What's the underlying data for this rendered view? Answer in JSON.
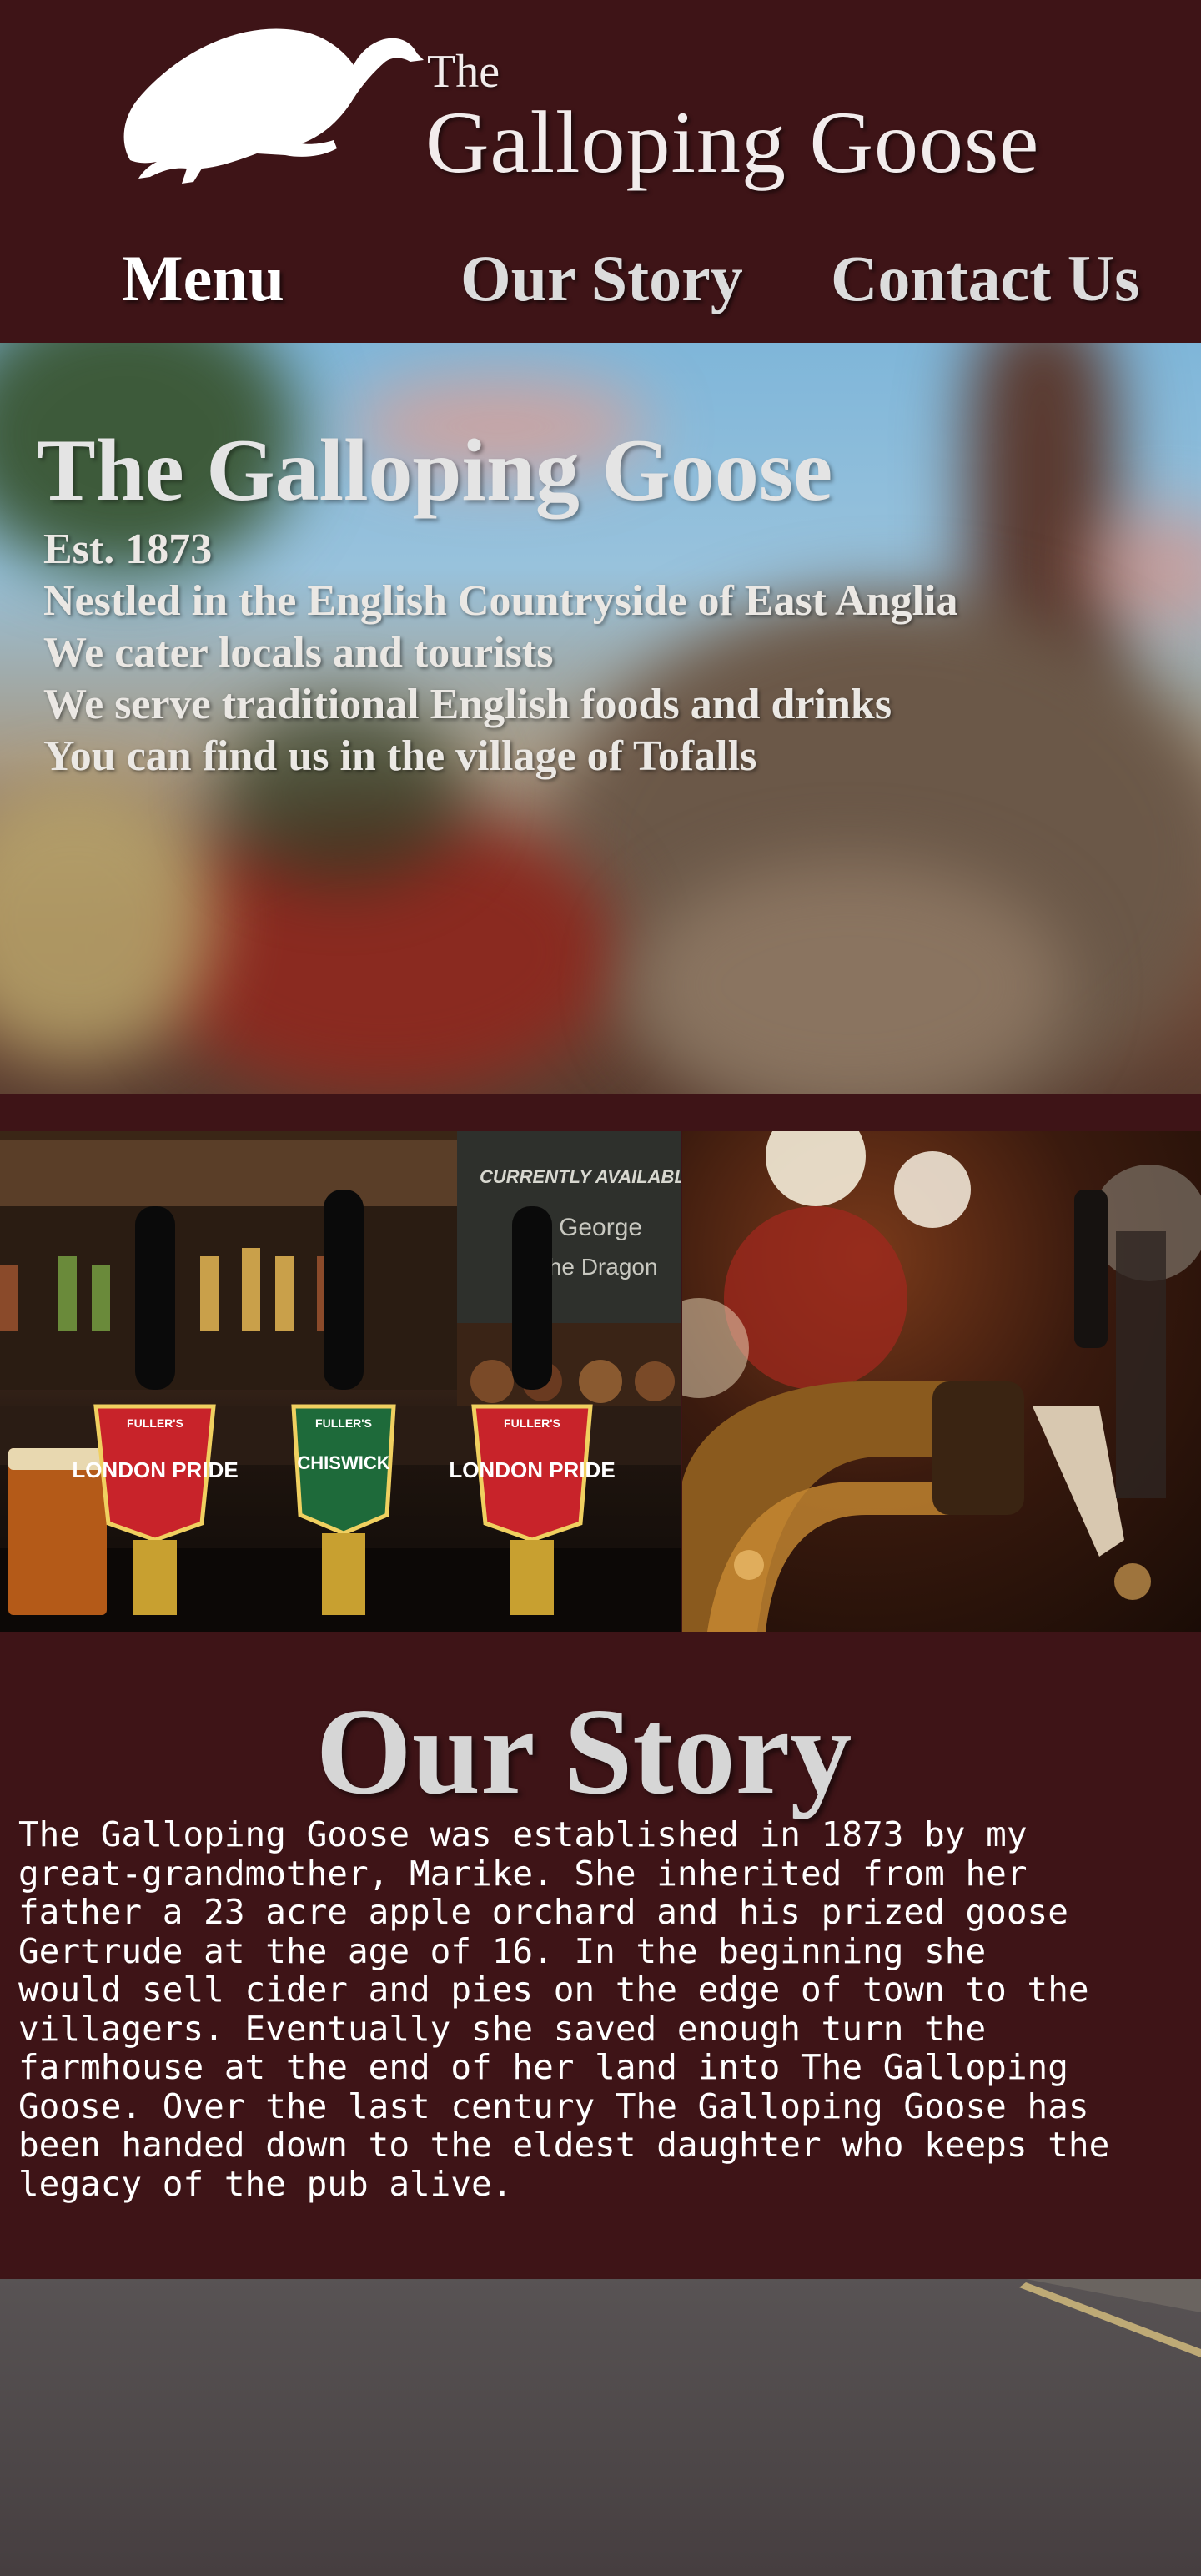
{
  "logo": {
    "the": "The",
    "name": "Galloping Goose",
    "icon": "goose-icon"
  },
  "nav": {
    "items": [
      {
        "label": "Menu"
      },
      {
        "label": "Our Story"
      },
      {
        "label": "Contact Us"
      }
    ]
  },
  "hero": {
    "title": "The Galloping Goose",
    "lines": [
      "Est. 1873",
      "Nestled in the English Countryside of East Anglia",
      "We cater locals and tourists",
      "We serve traditional English foods and drinks",
      "You can find us in the village of Tofalls"
    ],
    "image": "pub-exterior-photo"
  },
  "gallery": {
    "left": {
      "image": "beer-pumps-photo",
      "chalkboard": [
        "CURRENTLY AVAILABLE",
        "George",
        "the Dragon"
      ],
      "pumps": [
        {
          "brand": "FULLER'S",
          "name": "LONDON PRIDE"
        },
        {
          "brand": "FULLER'S",
          "name": "CHISWICK"
        },
        {
          "brand": "FULLER'S",
          "name": "LONDON PRIDE"
        }
      ]
    },
    "right": {
      "image": "beer-tap-photo"
    }
  },
  "story": {
    "title": "Our Story",
    "body": "The Galloping Goose was established in 1873 by my\ngreat-grandmother, Marike. She inherited from her\nfather a 23 acre apple orchard and his prized goose\nGertrude at the age of 16. In the beginning she\nwould sell cider and pies on the edge of town to the\nvillagers. Eventually she saved enough turn the\nfarmhouse at the end of her land into The Galloping\nGoose. Over the last century The Galloping Goose has\nbeen handed down to the eldest daughter who keeps the\nlegacy of the pub alive."
  },
  "footer": {
    "image": "road-photo"
  },
  "colors": {
    "background": "#3e1417",
    "text": "#ffffff",
    "heading": "#d6d6d6"
  }
}
